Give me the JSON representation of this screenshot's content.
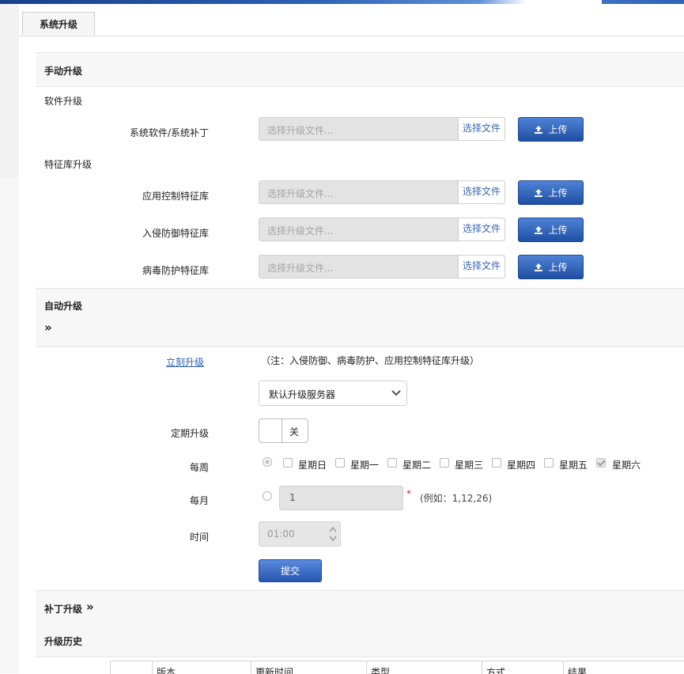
{
  "tab": {
    "label": "系统升级"
  },
  "manual": {
    "title": "手动升级",
    "software_heading": "软件升级",
    "signature_heading": "特征库升级",
    "rows": [
      {
        "label": "系统软件/系统补丁",
        "placeholder": "选择升级文件...",
        "pick": "选择文件",
        "upload": "上传"
      },
      {
        "label": "应用控制特征库",
        "placeholder": "选择升级文件...",
        "pick": "选择文件",
        "upload": "上传"
      },
      {
        "label": "入侵防御特征库",
        "placeholder": "选择升级文件...",
        "pick": "选择文件",
        "upload": "上传"
      },
      {
        "label": "病毒防护特征库",
        "placeholder": "选择升级文件...",
        "pick": "选择文件",
        "upload": "上传"
      }
    ]
  },
  "auto": {
    "title": "自动升级",
    "expand": "»",
    "upgrade_now": "立刻升级",
    "note": "（注：入侵防御、病毒防护、应用控制特征库升级）",
    "server": "默认升级服务器",
    "schedule_label": "定期升级",
    "toggle": "关",
    "weekly_label": "每周",
    "days": [
      {
        "label": "星期日",
        "checked": false
      },
      {
        "label": "星期一",
        "checked": false
      },
      {
        "label": "星期二",
        "checked": false
      },
      {
        "label": "星期三",
        "checked": false
      },
      {
        "label": "星期四",
        "checked": false
      },
      {
        "label": "星期五",
        "checked": false
      },
      {
        "label": "星期六",
        "checked": true
      }
    ],
    "monthly_label": "每月",
    "monthly_value": "1",
    "required_mark": "*",
    "monthly_hint": "(例如：1,12,26)",
    "time_label": "时间",
    "time_value": "01:00",
    "submit": "提交"
  },
  "patch": {
    "title": "补丁升级",
    "expand": "»"
  },
  "history": {
    "title": "升级历史",
    "columns": [
      "版本",
      "更新时间",
      "类型",
      "方式",
      "结果"
    ]
  },
  "colors": {
    "accent": "#2555ad",
    "link": "#2a5fb0",
    "required": "#e02020"
  }
}
